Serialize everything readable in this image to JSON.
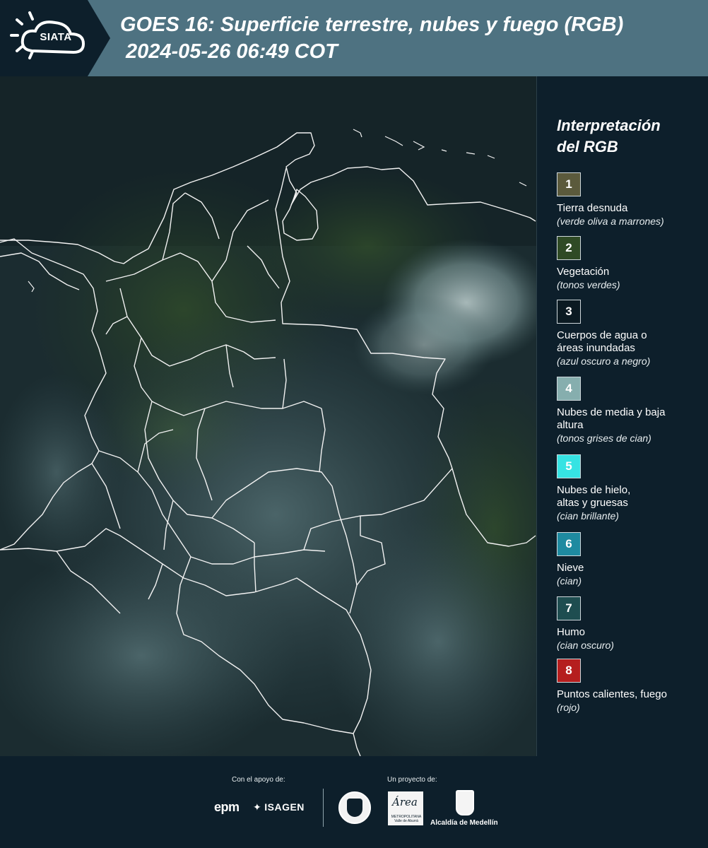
{
  "header": {
    "logo_text": "SIATA",
    "title_line1": "GOES 16: Superficie terrestre, nubes y fuego (RGB)",
    "title_line2": "2024-05-26 06:49 COT",
    "colors": {
      "bar": "#4e7281",
      "logo_panel": "#0d1f2b"
    }
  },
  "legend": {
    "title_line1": "Interpretación",
    "title_line2": "del RGB",
    "items": [
      {
        "number": "1",
        "label": "Tierra desnuda",
        "note": "(verde oliva a marrones)",
        "color": "#5b5a3c"
      },
      {
        "number": "2",
        "label": "Vegetación",
        "note": "(tonos verdes)",
        "color": "#2f4a25"
      },
      {
        "number": "3",
        "label": "Cuerpos de agua o áreas inundadas",
        "note": "(azul oscuro a negro)",
        "color": "#0b1a22"
      },
      {
        "number": "4",
        "label": "Nubes de media y baja altura",
        "note": "(tonos grises de cian)",
        "color": "#86aeae"
      },
      {
        "number": "5",
        "label": "Nubes de hielo, altas y gruesas",
        "note": "(cian brillante)",
        "color": "#36e3e3"
      },
      {
        "number": "6",
        "label": "Nieve",
        "note": "(cian)",
        "color": "#1e8aa0"
      },
      {
        "number": "7",
        "label": "Humo",
        "note": "(cian oscuro)",
        "color": "#1e4d50"
      },
      {
        "number": "8",
        "label": "Puntos calientes, fuego",
        "note": "(rojo)",
        "color": "#b51e1e"
      }
    ]
  },
  "footer": {
    "support_caption": "Con el apoyo de:",
    "project_caption": "Un proyecto de:",
    "partners": {
      "epm": "epm",
      "isagen": "ISAGEN",
      "amva_script": "Área",
      "amva_small": "METROPOLITANA Valle de Aburrá",
      "alcaldia": "Alcaldía de Medellín"
    }
  }
}
